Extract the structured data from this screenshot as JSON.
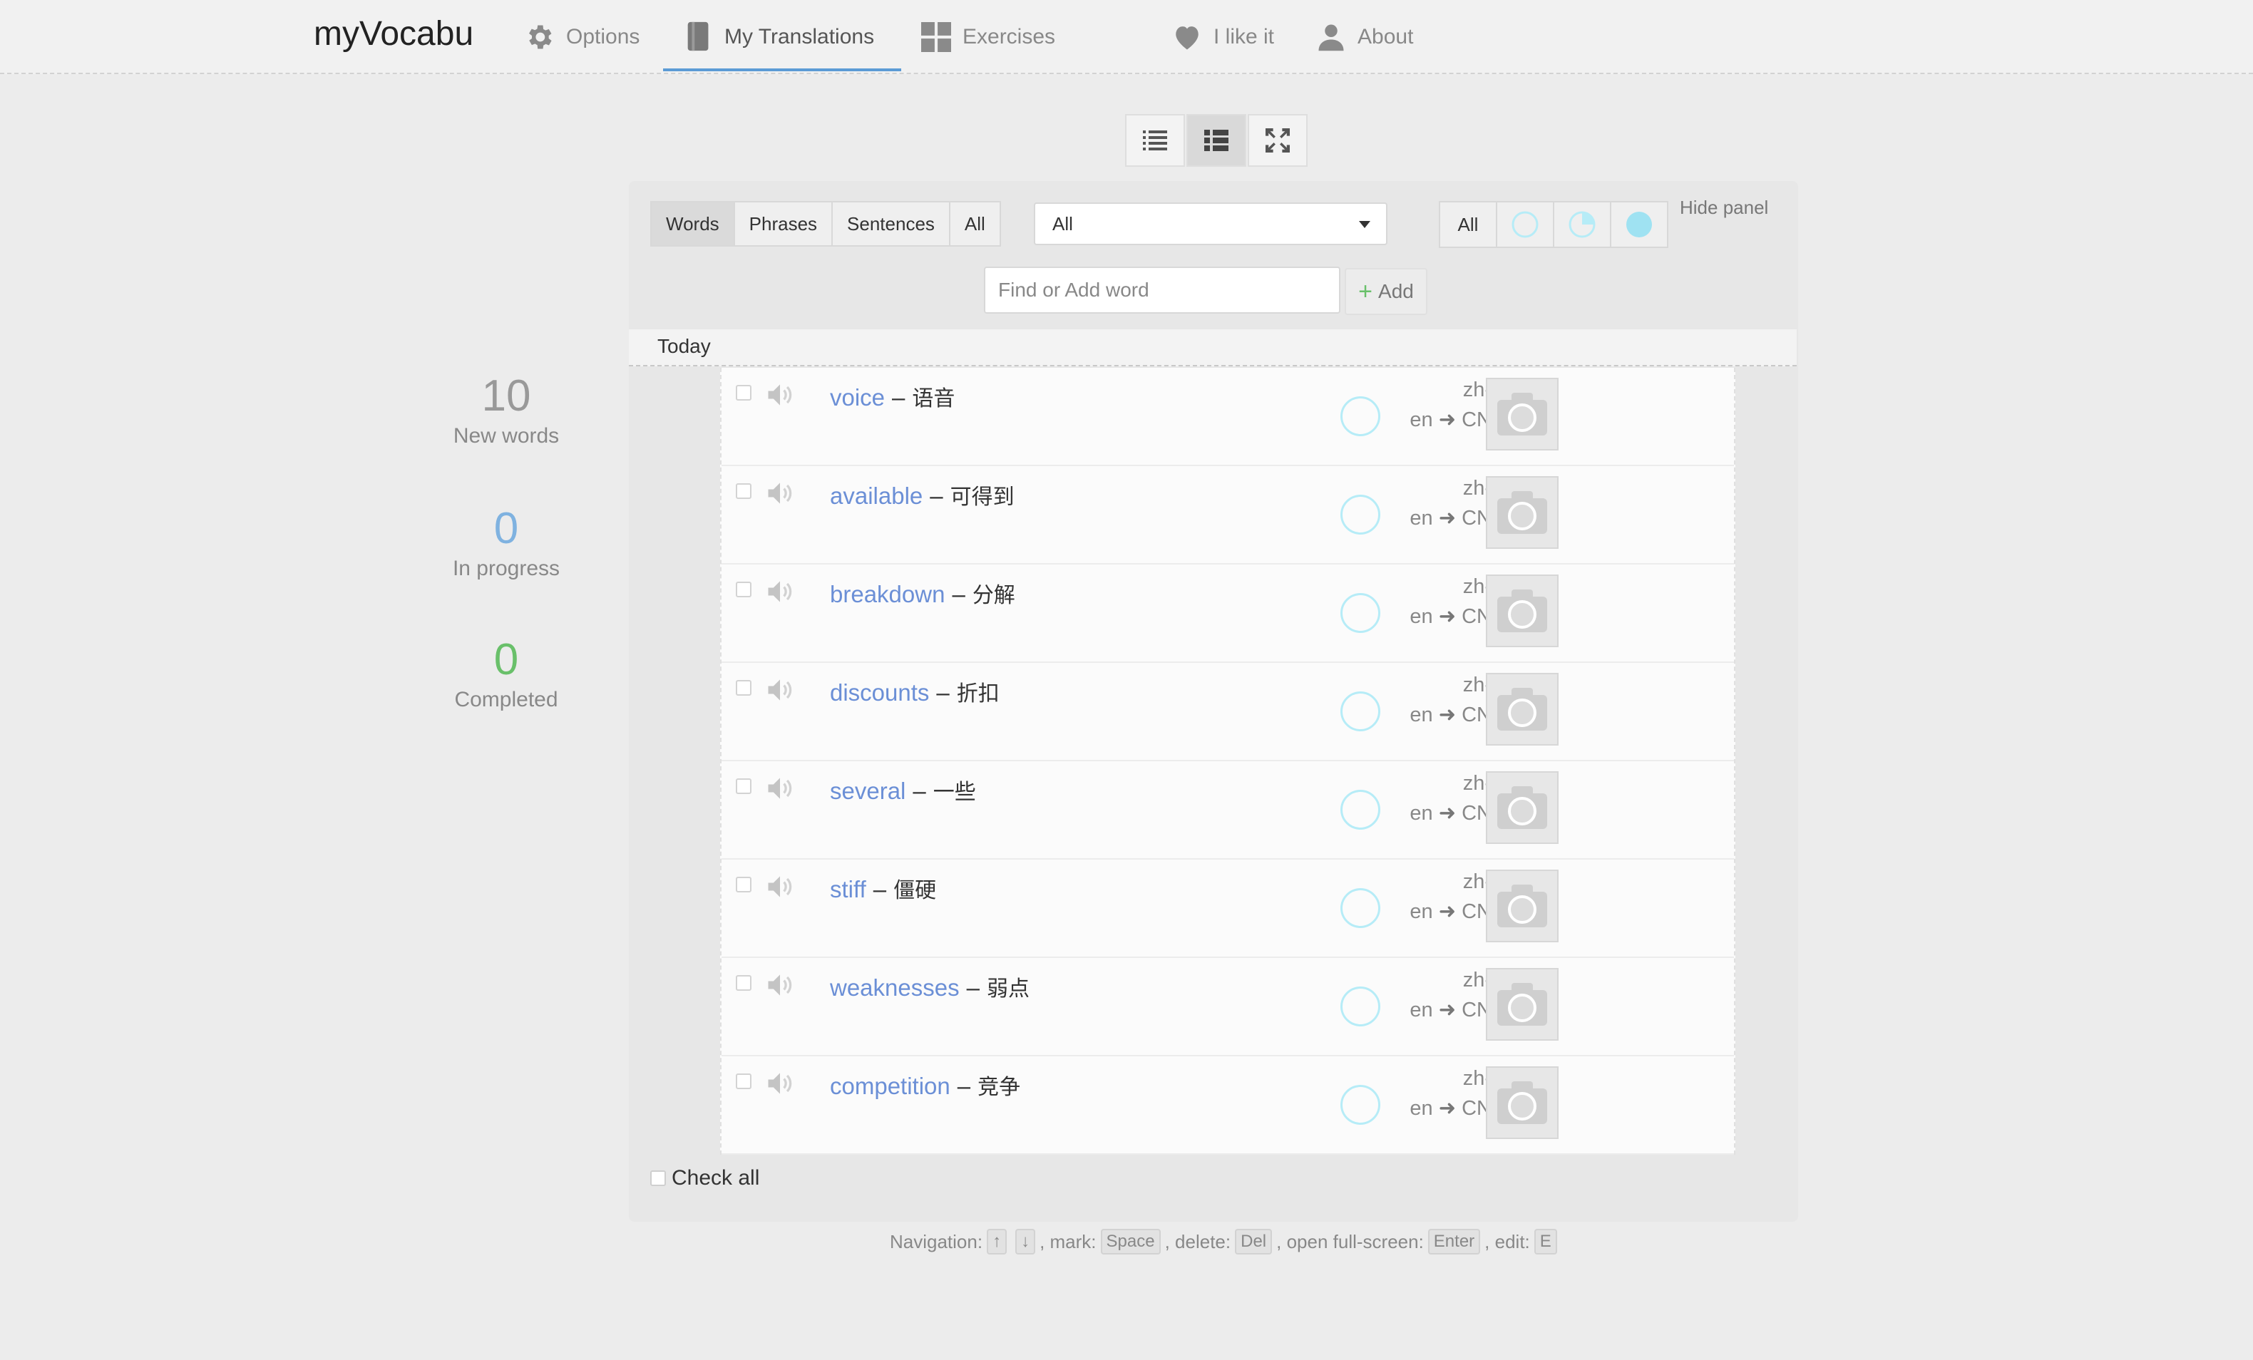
{
  "app": {
    "title": "myVocabu"
  },
  "nav": {
    "options": "Options",
    "my_translations": "My Translations",
    "exercises": "Exercises",
    "like": "I like it",
    "about": "About"
  },
  "filters": {
    "types": [
      "Words",
      "Phrases",
      "Sentences",
      "All"
    ],
    "active_type": "Words",
    "category_select": "All",
    "status_all": "All",
    "hide_panel": "Hide panel"
  },
  "search": {
    "placeholder": "Find or Add word",
    "add_label": "Add"
  },
  "section": {
    "today": "Today"
  },
  "stats": {
    "new": {
      "count": "10",
      "label": "New words",
      "color": "#999999"
    },
    "in_progress": {
      "count": "0",
      "label": "In progress",
      "color": "#7fb2e0"
    },
    "completed": {
      "count": "0",
      "label": "Completed",
      "color": "#69c06a"
    }
  },
  "words": [
    {
      "word": "voice",
      "translation": "语音"
    },
    {
      "word": "available",
      "translation": "可得到"
    },
    {
      "word": "breakdown",
      "translation": "分解"
    },
    {
      "word": "discounts",
      "translation": "折扣"
    },
    {
      "word": "several",
      "translation": "一些"
    },
    {
      "word": "stiff",
      "translation": "僵硬"
    },
    {
      "word": "weaknesses",
      "translation": "弱点"
    },
    {
      "word": "competition",
      "translation": "竞争"
    }
  ],
  "lang": {
    "to_top": "zh-",
    "from": "en",
    "to_bottom": "CN"
  },
  "dash": "–",
  "check_all": "Check all",
  "shortcuts": {
    "navigation": "Navigation:",
    "up": "↑",
    "down": "↓",
    "mark": ", mark:",
    "space": "Space",
    "delete": ", delete:",
    "del": "Del",
    "fullscreen": ", open full-screen:",
    "enter": "Enter",
    "edit": ", edit:",
    "e": "E"
  },
  "colors": {
    "accent": "#5b9bd5",
    "word_link": "#6b8fd6",
    "ring": "#b6ecf7",
    "add_plus": "#69c06a"
  }
}
